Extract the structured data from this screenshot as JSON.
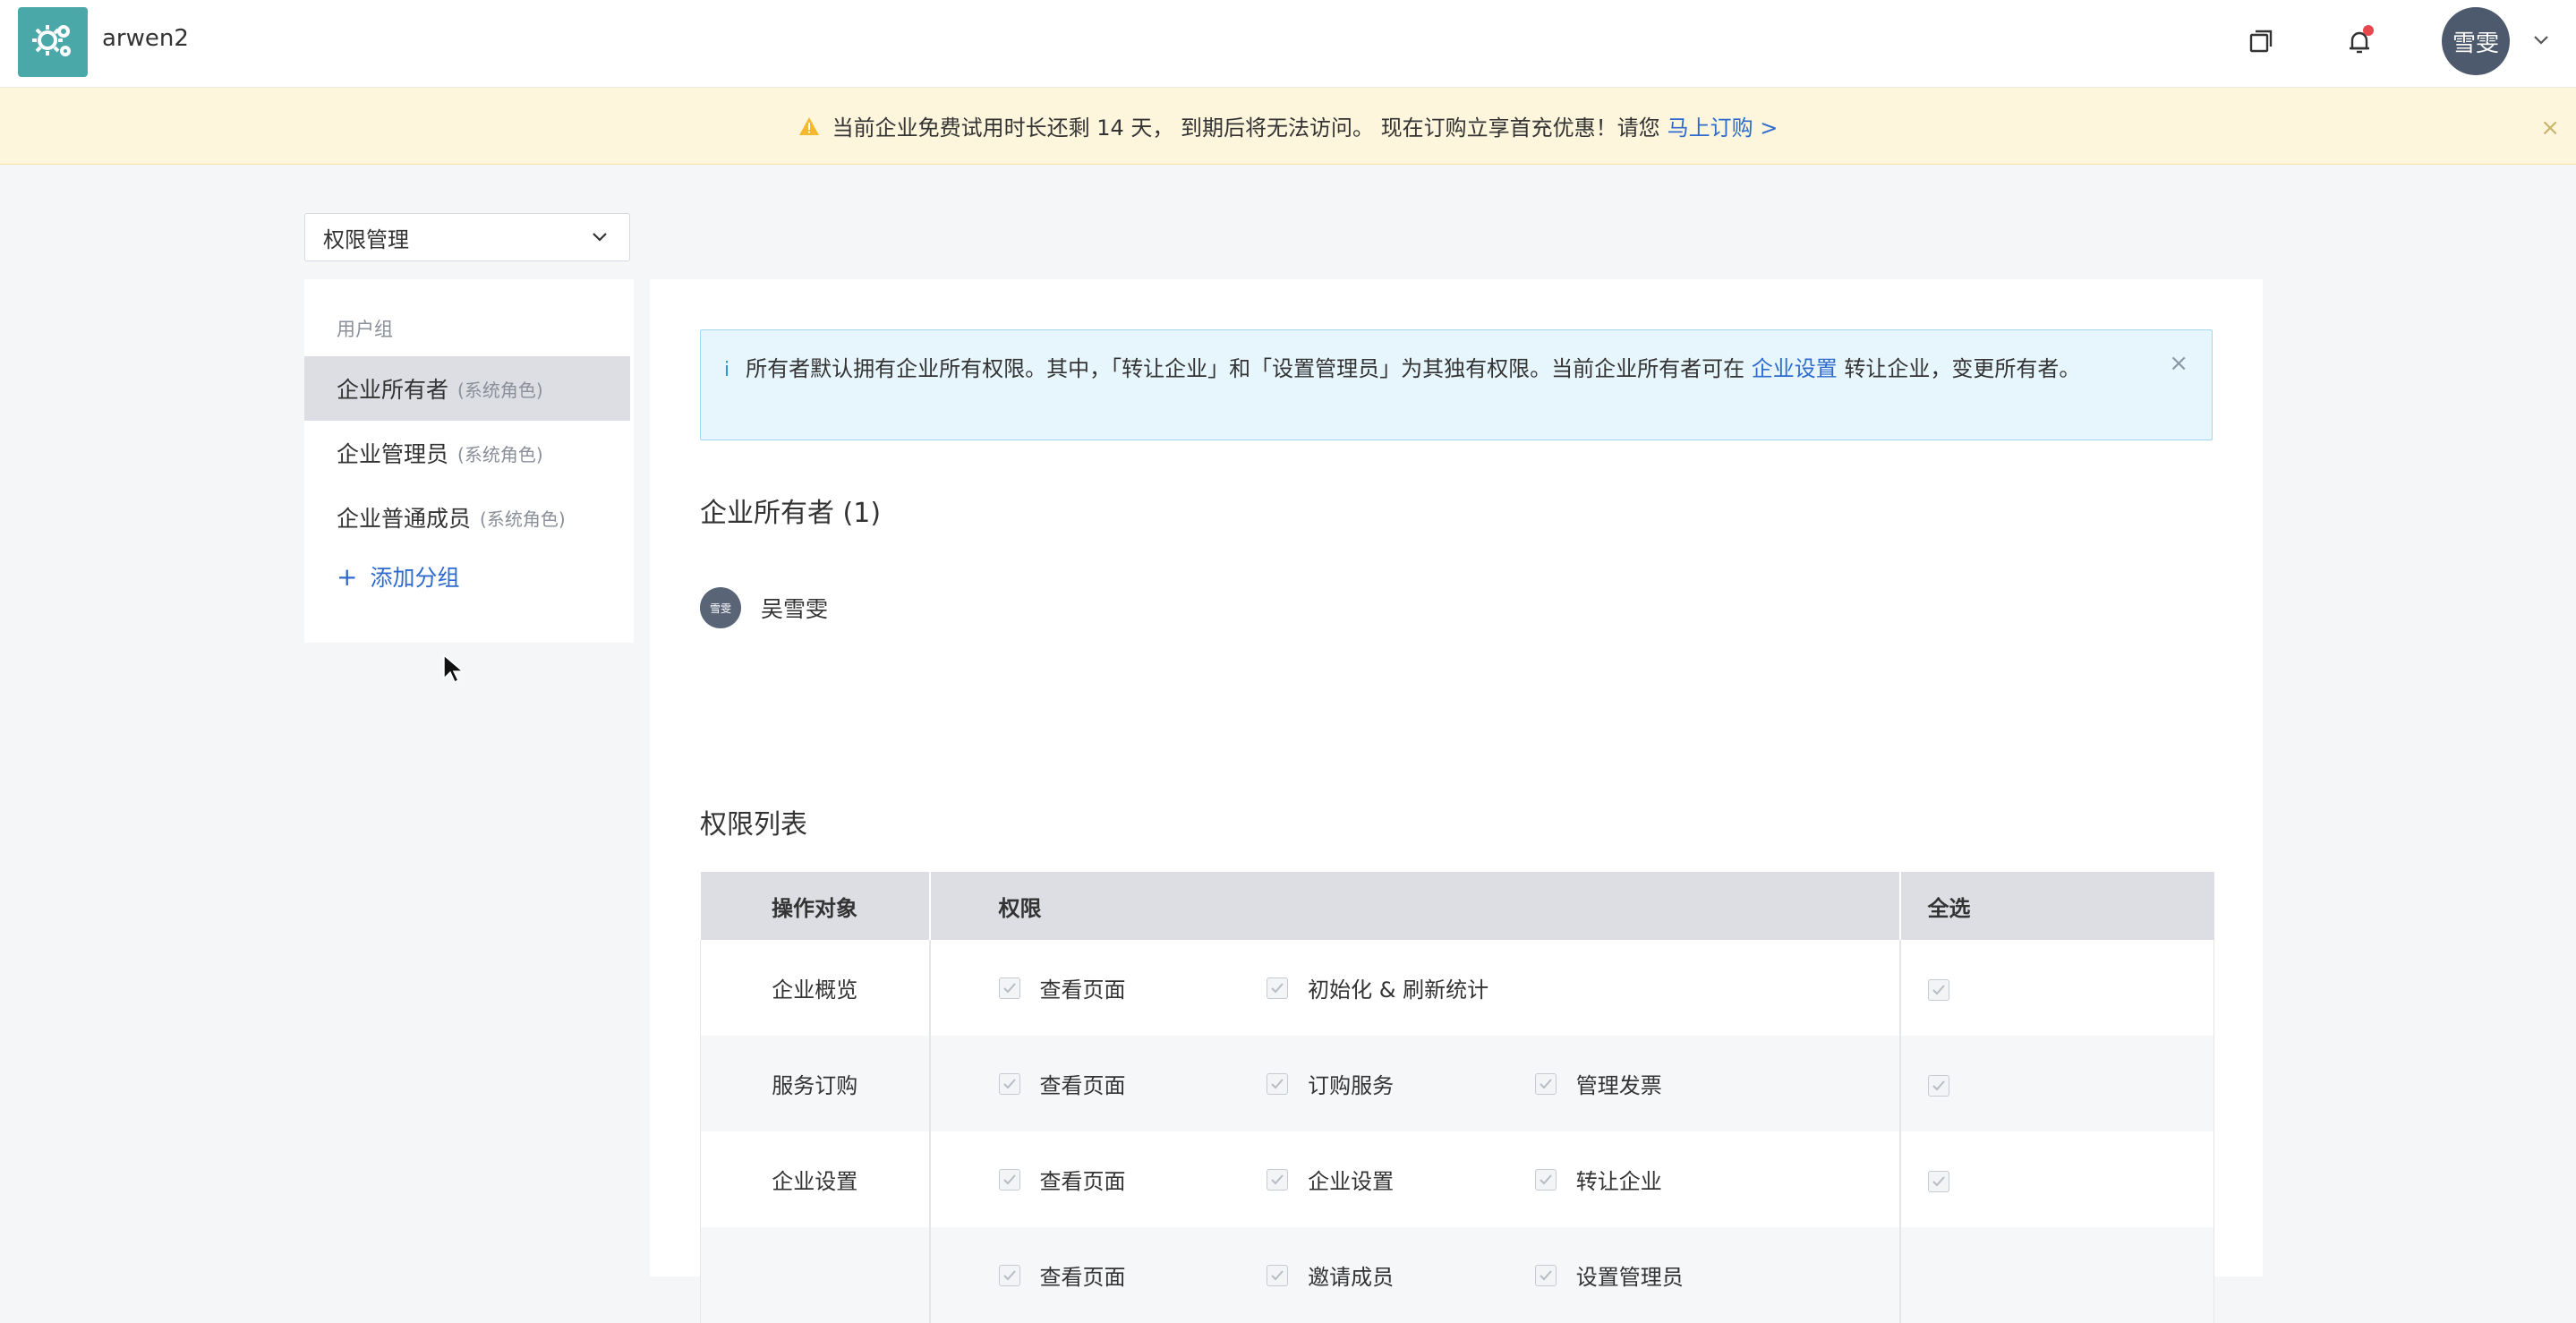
{
  "header": {
    "app_title": "arwen2",
    "avatar_text": "雪雯"
  },
  "banner": {
    "message": "当前企业免费试用时长还剩 14 天， 到期后将无法访问。 现在订购立享首充优惠！请您",
    "link": "马上订购 >"
  },
  "scope_select": {
    "value": "权限管理"
  },
  "sidebar": {
    "heading": "用户组",
    "items": [
      {
        "label": "企业所有者",
        "role": "(系统角色)"
      },
      {
        "label": "企业管理员",
        "role": "(系统角色)"
      },
      {
        "label": "企业普通成员",
        "role": "(系统角色)"
      }
    ],
    "add_label": "添加分组"
  },
  "info": {
    "icon": "i",
    "text_before": "所有者默认拥有企业所有权限。其中，「转让企业」和「设置管理员」为其独有权限。当前企业所有者可在",
    "link": "企业设置",
    "text_after": "转让企业，变更所有者。"
  },
  "owner_section": {
    "title": "企业所有者 (1)",
    "member": {
      "avatar": "雪雯",
      "name": "吴雪雯"
    }
  },
  "permissions": {
    "title": "权限列表",
    "columns": [
      "操作对象",
      "权限",
      "全选"
    ],
    "rows": [
      {
        "object": "企业概览",
        "perms": [
          "查看页面",
          "初始化 & 刷新统计"
        ]
      },
      {
        "object": "服务订购",
        "perms": [
          "查看页面",
          "订购服务",
          "管理发票"
        ]
      },
      {
        "object": "企业设置",
        "perms": [
          "查看页面",
          "企业设置",
          "转让企业"
        ]
      },
      {
        "object": "",
        "perms": [
          "查看页面",
          "邀请成员",
          "设置管理员"
        ]
      }
    ]
  },
  "colors": {
    "link": "#2f6bce",
    "banner_bg": "#fdf6dd",
    "info_bg": "#e7f6fc",
    "logo_bg": "#4aa8a8"
  }
}
